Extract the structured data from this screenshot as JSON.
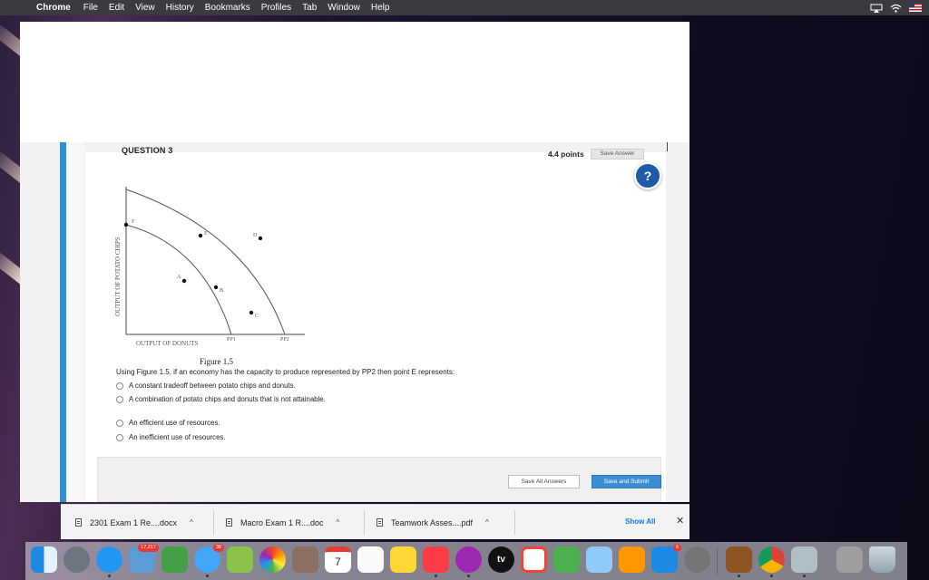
{
  "menubar": {
    "app_name": "Chrome",
    "menu_items": [
      "File",
      "Edit",
      "View",
      "History",
      "Bookmarks",
      "Profiles",
      "Tab",
      "Window",
      "Help"
    ]
  },
  "question": {
    "title": "QUESTION 3",
    "points": "4.4 points",
    "save_answer_label": "Save Answer",
    "help_label": "?"
  },
  "figure": {
    "y_axis_label": "OUTPUT OF POTATO CHIPS",
    "x_axis_label": "OUTPUT OF DONUTS",
    "curve_labels": [
      "PP1",
      "PP2"
    ],
    "point_labels": [
      "F",
      "E",
      "D",
      "A",
      "B",
      "C"
    ],
    "caption": "Figure 1.5"
  },
  "prompt": "Using Figure 1.5, if an economy has the capacity to produce represented by PP2 then point E represents:",
  "options": [
    "A constant tradeoff between potato chips and donuts.",
    "A combination of potato chips and donuts that is not attainable.",
    "An efficient use of resources.",
    "An inefficient use of resources."
  ],
  "footer": {
    "save_all_label": "Save All Answers",
    "save_submit_label": "Save and Submit"
  },
  "downloads": {
    "items": [
      "2301 Exam 1 Re....docx",
      "Macro Exam 1 R....doc",
      "Teamwork Asses....pdf"
    ],
    "show_all_label": "Show All",
    "close_label": "✕"
  },
  "dock": {
    "calendar_day": "7",
    "tv_label": "tv",
    "badges": [
      "17,217",
      "38",
      "6"
    ]
  }
}
